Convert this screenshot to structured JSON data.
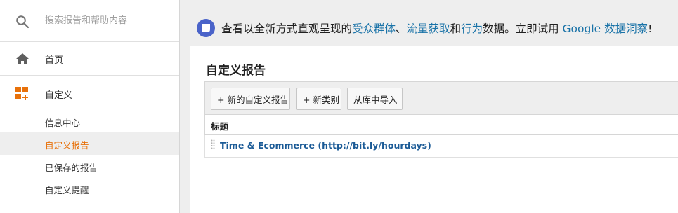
{
  "sidebar": {
    "search": {
      "placeholder": "搜索报告和帮助内容",
      "icon": "search-icon"
    },
    "home": {
      "label": "首页",
      "icon": "home-icon"
    },
    "customization": {
      "label": "自定义",
      "icon": "customization-grid-icon",
      "icon_color": "#e8710a"
    },
    "sub_items": [
      {
        "label": "信息中心",
        "active": false
      },
      {
        "label": "自定义报告",
        "active": true
      },
      {
        "label": "已保存的报告",
        "active": false
      },
      {
        "label": "自定义提醒",
        "active": false
      }
    ]
  },
  "banner": {
    "icon": "insights-icon",
    "text_1": "查看以全新方式直观呈现的",
    "link_audience": "受众群体",
    "text_2": "、",
    "link_acquisition": "流量获取",
    "text_3": "和",
    "link_behavior": "行为",
    "text_4": "数据。立即试用 ",
    "link_studio": "Google 数据洞察",
    "text_5": "!",
    "link_color": "#1a73a8"
  },
  "main": {
    "title": "自定义报告",
    "toolbar": {
      "new_report_label": "+ 新的自定义报告",
      "new_category_label": "+ 新类别",
      "import_label": "从库中导入"
    },
    "table": {
      "header": "标题",
      "rows": [
        {
          "title": "Time & Ecommerce (http://bit.ly/hourdays)"
        }
      ]
    }
  },
  "colors": {
    "accent": "#e8710a",
    "link": "#1a5a96",
    "active_bg": "#eeeeee"
  }
}
